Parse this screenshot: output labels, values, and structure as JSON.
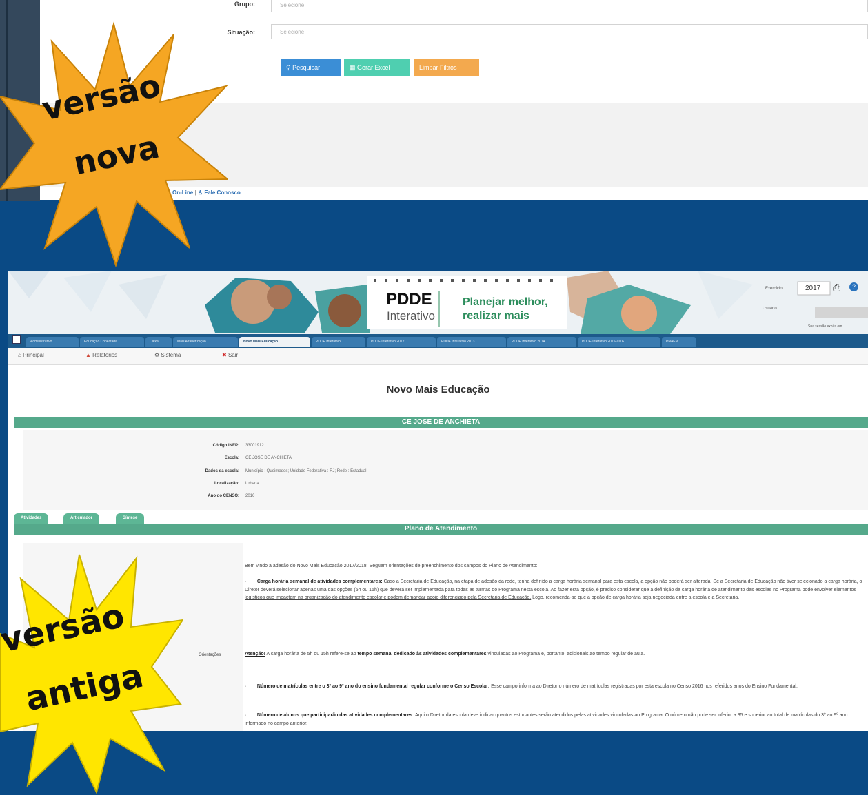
{
  "new_version": {
    "filters": [
      {
        "label": "Grupo:",
        "placeholder": "Selecione"
      },
      {
        "label": "Situação:",
        "placeholder": "Selecione"
      }
    ],
    "buttons": {
      "search": "Pesquisar",
      "excel": "Gerar Excel",
      "clear": "Limpar Filtros"
    },
    "footer": {
      "online": "On-Line",
      "contact": "Fale Conosco"
    },
    "badge": {
      "line1": "versão",
      "line2": "nova",
      "color": "#f5a623"
    }
  },
  "old_version": {
    "banner": {
      "brand_pdde": "PDDE",
      "brand_interativo": "Interativo",
      "slogan_line1": "Planejar melhor,",
      "slogan_line2": "realizar mais",
      "exercicio_label": "Exercício",
      "exercicio_value": "2017",
      "usuario_label": "Usuário",
      "status_text": "Sua sessão expira em"
    },
    "tabs": [
      "Administrativo",
      "Educação Conectada",
      "Caixa",
      "Mais Alfabetização",
      "Novo Mais Educação",
      "PDDE Interativo",
      "PDDE Interativo 2012",
      "PDDE Interativo 2013",
      "PDDE Interativo 2014",
      "PDDE Interativo 2015/2016",
      "PNAEM"
    ],
    "active_tab": "Novo Mais Educação",
    "menu": [
      "Principal",
      "Relatórios",
      "Sistema",
      "Sair"
    ],
    "page_title": "Novo Mais Educação",
    "school_name": "CE JOSE DE ANCHIETA",
    "school_info": [
      {
        "label": "Código INEP:",
        "value": "33001912"
      },
      {
        "label": "Escola:",
        "value": "CE JOSE DE ANCHIETA"
      },
      {
        "label": "Dados da escola:",
        "value": "Município : Queimados; Unidade Federativa : RJ; Rede : Estadual"
      },
      {
        "label": "Localização:",
        "value": "Urbana"
      },
      {
        "label": "Ano do CENSO:",
        "value": "2016"
      }
    ],
    "sub_tabs": [
      "Atividades",
      "Articulador",
      "Síntese"
    ],
    "plan_title": "Plano de Atendimento",
    "orientacoes_label": "Orientações",
    "intro": "Bem vindo à adesão do Novo Mais Educação 2017/2018! Seguem orientações de preenchimento dos campos do Plano de Atendimento:",
    "p1_bold": "Carga horária semanal de atividades complementares:",
    "p1_text": "Caso a Secretaria de Educação, na etapa de adesão da rede, tenha definido a carga horária semanal para esta escola, a opção não poderá ser alterada. Se a Secretaria de Educação não tiver selecionado a carga horária, o Diretor deverá selecionar apenas uma das opções (5h ou 15h) que deverá ser implementada para todas as turmas do Programa nesta escola. Ao fazer esta opção,",
    "p1_underline": "é preciso considerar que a definição da carga horária de atendimento das escolas no Programa pode envolver elementos logísticos que impactam na organização do atendimento escolar e podem demandar apoio diferenciado pela Secretaria de Educação.",
    "p1_end": "Logo, recomenda-se que a opção de carga horária seja negociada entre a escola e a Secretaria.",
    "atencao_label": "Atenção!",
    "atencao_text1": "A carga horária de 5h ou 15h refere-se ao",
    "atencao_bold": "tempo semanal dedicado às atividades complementares",
    "atencao_text2": "vinculadas ao Programa e, portanto, adicionais ao tempo regular de aula.",
    "p2_bold": "Número de matrículas entre o 3º ao 9º ano do ensino fundamental regular conforme o Censo Escolar:",
    "p2_text": "Esse campo informa ao Diretor o número de matrículas registradas por esta escola no Censo 2016 nos referidos anos do Ensino Fundamental.",
    "p3_bold": "Número de alunos que participarão das atividades complementares:",
    "p3_text": "Aqui o Diretor da escola deve indicar quantos estudantes serão atendidos pelas atividades vinculadas ao Programa. O número não pode ser inferior a 35 e superior ao total de matrículas do 3º ao 9º ano informado no campo anterior.",
    "badge": {
      "line1": "versão",
      "line2": "antiga",
      "color": "#ffe600"
    }
  },
  "colors": {
    "background": "#0a4a85",
    "search_btn": "#3b8ed6",
    "excel_btn": "#4fcfb0",
    "clear_btn": "#f3a94e",
    "green_header": "#55a98b"
  }
}
